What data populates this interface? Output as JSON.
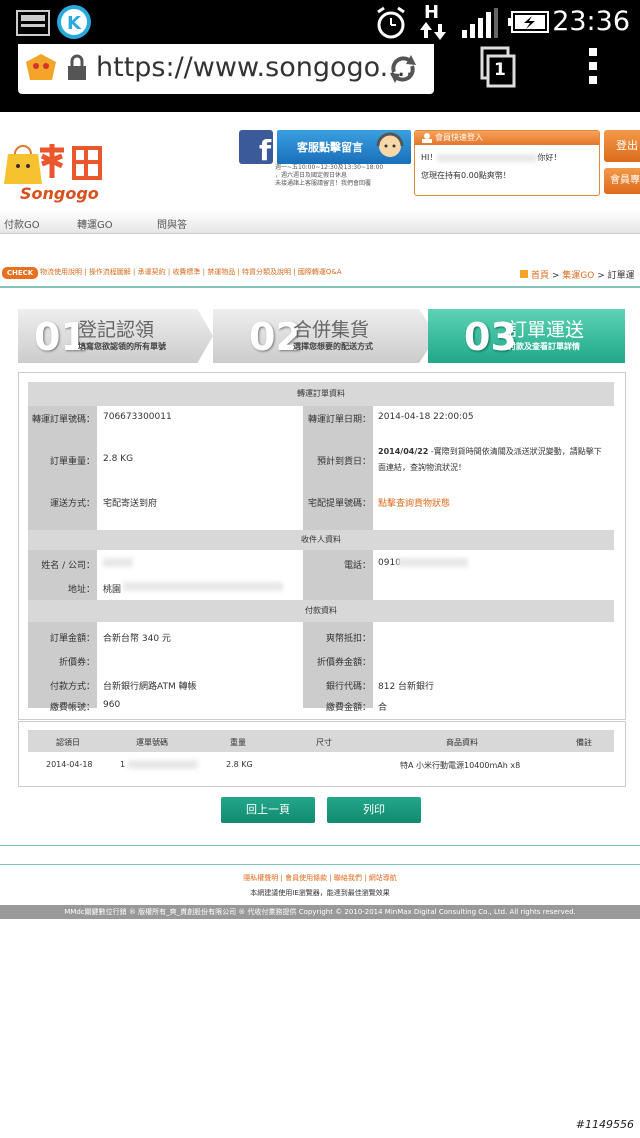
{
  "statusbar": {
    "time": "23:36",
    "net": "H"
  },
  "browser": {
    "url": "https://www.songogo....",
    "tabs": "1"
  },
  "site": {
    "logo_en": "Songogo",
    "service_btn": "客服點擊留言",
    "service_hours": [
      "週一~五10:00~12:30及13:30~18:00",
      "，週六週日及國定假日休息",
      "未接通諸上客服請留言！我們會回覆"
    ],
    "member_title": "會員快速登入",
    "member_hi": "HI！",
    "member_hi_suffix": "你好！",
    "member_points": "您現在持有0.00點爽幣！",
    "login_btn": "登出",
    "member_btn": "會員專"
  },
  "menu": [
    "付款GO",
    "轉運GO",
    "問與答"
  ],
  "check": {
    "badge": "CHECK",
    "links": [
      "物流使用說明",
      "操作流程圖解",
      "承運契約",
      "收費標準",
      "禁運物品",
      "特貨分類及說明",
      "國際轉運Q&A"
    ]
  },
  "breadcrumb": {
    "home": "首頁",
    "sec": "集運GO",
    "cur": "訂單運"
  },
  "steps": [
    {
      "num": "01",
      "title": "登記認領",
      "sub": "填寫您欲認領的所有單號"
    },
    {
      "num": "02",
      "title": "合併集貨",
      "sub": "選擇您想要的配送方式"
    },
    {
      "num": "03",
      "title": "訂單運送",
      "sub": "付款及查看訂單詳情"
    }
  ],
  "order": {
    "section1": "轉運訂單資料",
    "order_no_label": "轉運訂單號碼：",
    "order_no": "706673300011",
    "order_date_label": "轉運訂單日期：",
    "order_date": "2014-04-18 22:00:05",
    "weight_label": "訂單重量：",
    "weight": "2.8 KG",
    "eta_label": "預計到貨日：",
    "eta_bold": "2014/04/22",
    "eta_rest": " -實際到貨時間依清關及派送狀況變動，請點擊下面連結，查詢物流狀況！",
    "ship_label": "運送方式：",
    "ship": "宅配寄送到府",
    "track_label": "宅配提單號碼：",
    "track": "點擊查詢貨物狀態",
    "section2": "收件人資料",
    "name_label": "姓名 / 公司：",
    "phone_label": "電話：",
    "phone": "0910",
    "addr_label": "地址：",
    "addr": "桃園",
    "section3": "付款資料",
    "amount_label": "訂單金額：",
    "amount": "合新台幣 340 元",
    "coin_label": "爽幣抵扣：",
    "coupon_label": "折價券：",
    "coupon_amt_label": "折價券金額：",
    "pay_label": "付款方式：",
    "pay": "台新銀行網路ATM 轉帳",
    "bank_label": "銀行代碼：",
    "bank": "812 台新銀行",
    "acct_label": "繳費帳號：",
    "acct": "960",
    "fee_label": "繳費金額：",
    "fee": "合"
  },
  "items": {
    "headers": [
      "認領日",
      "運單號碼",
      "重量",
      "尺寸",
      "商品資料",
      "備註"
    ],
    "rows": [
      {
        "date": "2014-04-18",
        "waybill": "1",
        "weight": "2.8 KG",
        "size": "",
        "product": "特A 小米行動電源10400mAh x8",
        "note": ""
      }
    ]
  },
  "buttons": {
    "back": "回上一頁",
    "print": "列印"
  },
  "footer": {
    "links": "隱私權聲明 | 會員使用條款 | 聯絡我們 | 網站導航",
    "tip": "本網建議使用IE瀏覽器，能達到最佳瀏覽效果",
    "copyright": "MMdc關鍵數位行銷 ® 版權所有_爽_貫創股份有限公司 ® 代收付業務提供 Copyright © 2010-2014 MinMax Digital Consulting Co., Ltd. All rights reserved."
  },
  "watermark": "#1149556"
}
